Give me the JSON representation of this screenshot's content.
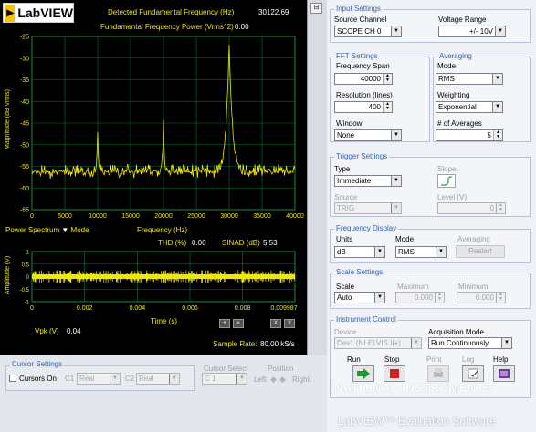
{
  "header": {
    "logo_text": "LabVIEW",
    "detected_freq_label": "Detected Fundamental Frequency (Hz)",
    "detected_freq_value": "30122.69",
    "fund_power_label": "Fundamental Frequency Power  (Vrms^2)",
    "fund_power_value": "0.00"
  },
  "spectrum": {
    "ylabel": "Magnitude (dB Vrms)",
    "xlabel": "Frequency (Hz)",
    "yticks": [
      "-25",
      "-30",
      "-35",
      "-40",
      "-45",
      "-50",
      "-55",
      "-60",
      "-65"
    ],
    "xticks": [
      "0",
      "5000",
      "10000",
      "15000",
      "20000",
      "25000",
      "30000",
      "35000",
      "40000"
    ],
    "selector_label": "Power Spectrum",
    "mode_label": "Mode",
    "thd_label": "THD (%)",
    "thd_value": "0.00",
    "sinad_label": "SINAD (dB)",
    "sinad_value": "5.53"
  },
  "chart_data": [
    {
      "type": "line",
      "xlabel": "Frequency (Hz)",
      "ylabel": "Magnitude (dB Vrms)",
      "xlim": [
        0,
        40000
      ],
      "ylim": [
        -65,
        -25
      ],
      "grid": true,
      "peaks": [
        {
          "x": 10000,
          "y": -47
        },
        {
          "x": 20000,
          "y": -44
        },
        {
          "x": 30000,
          "y": -26
        }
      ],
      "noise_floor": -57
    },
    {
      "type": "line",
      "xlabel": "Time (s)",
      "ylabel": "Amplitude (V)",
      "xlim": [
        0,
        0.009987
      ],
      "ylim": [
        -1,
        1
      ],
      "grid": true
    }
  ],
  "timeplot": {
    "ylabel": "Amplitude (V)",
    "xlabel": "Time (s)",
    "yticks": [
      "1",
      "0.5",
      "0",
      "-0.5",
      "-1"
    ],
    "xticks": [
      "0",
      "0.002",
      "0.004",
      "0.006",
      "0.008",
      "0.009987"
    ],
    "vpk_label": "Vpk (V)",
    "vpk_value": "0.04",
    "sample_rate_label": "Sample Rate:",
    "sample_rate_value": "80.00 kS/s"
  },
  "input_settings": {
    "title": "Input Settings",
    "source_channel_label": "Source Channel",
    "source_channel_value": "SCOPE CH 0",
    "voltage_range_label": "Voltage Range",
    "voltage_range_value": "+/- 10V"
  },
  "fft_settings": {
    "title": "FFT Settings",
    "freq_span_label": "Frequency Span",
    "freq_span_value": "40000",
    "resolution_label": "Resolution (lines)",
    "resolution_value": "400",
    "window_label": "Window",
    "window_value": "None"
  },
  "averaging": {
    "title": "Averaging",
    "mode_label": "Mode",
    "mode_value": "RMS",
    "weighting_label": "Weighting",
    "weighting_value": "Exponential",
    "num_avg_label": "# of Averages",
    "num_avg_value": "5"
  },
  "trigger_settings": {
    "title": "Trigger Settings",
    "type_label": "Type",
    "type_value": "Immediate",
    "slope_label": "Slope",
    "source_label": "Source",
    "source_value": "TRIG",
    "level_label": "Level (V)",
    "level_value": "0"
  },
  "frequency_display": {
    "title": "Frequency Display",
    "units_label": "Units",
    "units_value": "dB",
    "mode_label": "Mode",
    "mode_value": "RMS",
    "averaging_label": "Averaging",
    "restart_label": "Restart"
  },
  "scale_settings": {
    "title": "Scale Settings",
    "scale_label": "Scale",
    "scale_value": "Auto",
    "maximum_label": "Maximum",
    "maximum_value": "0.000",
    "minimum_label": "Minimum",
    "minimum_value": "0.000"
  },
  "instrument_control": {
    "title": "Instrument Control",
    "device_label": "Device",
    "device_value": "Dev1 (NI ELVIS II+)",
    "acq_mode_label": "Acquisition Mode",
    "acq_mode_value": "Run Continuously",
    "run_label": "Run",
    "stop_label": "Stop",
    "print_label": "Print",
    "log_label": "Log",
    "help_label": "Help"
  },
  "cursor_settings": {
    "title": "Cursor Settings",
    "cursors_on_label": "Cursors On",
    "c1_label": "C1",
    "c1_value": "Real",
    "c2_label": "C2",
    "c2_value": "Real",
    "cursor_select_label": "Cursor Select",
    "cursor_select_value": "C 1",
    "position_label": "Position",
    "left_label": "Left",
    "right_label": "Right"
  },
  "footer": {
    "ni_text": "NATIONAL INSTRUMENTS",
    "eval_text": "LabVIEW™ Evaluation Software"
  },
  "colors": {
    "plot_bg": "#000000",
    "grid": "#0a7a3a",
    "trace": "#f0e800",
    "panel_title": "#3565b3",
    "run_green": "#1c9a2c",
    "stop_red": "#d02020"
  }
}
